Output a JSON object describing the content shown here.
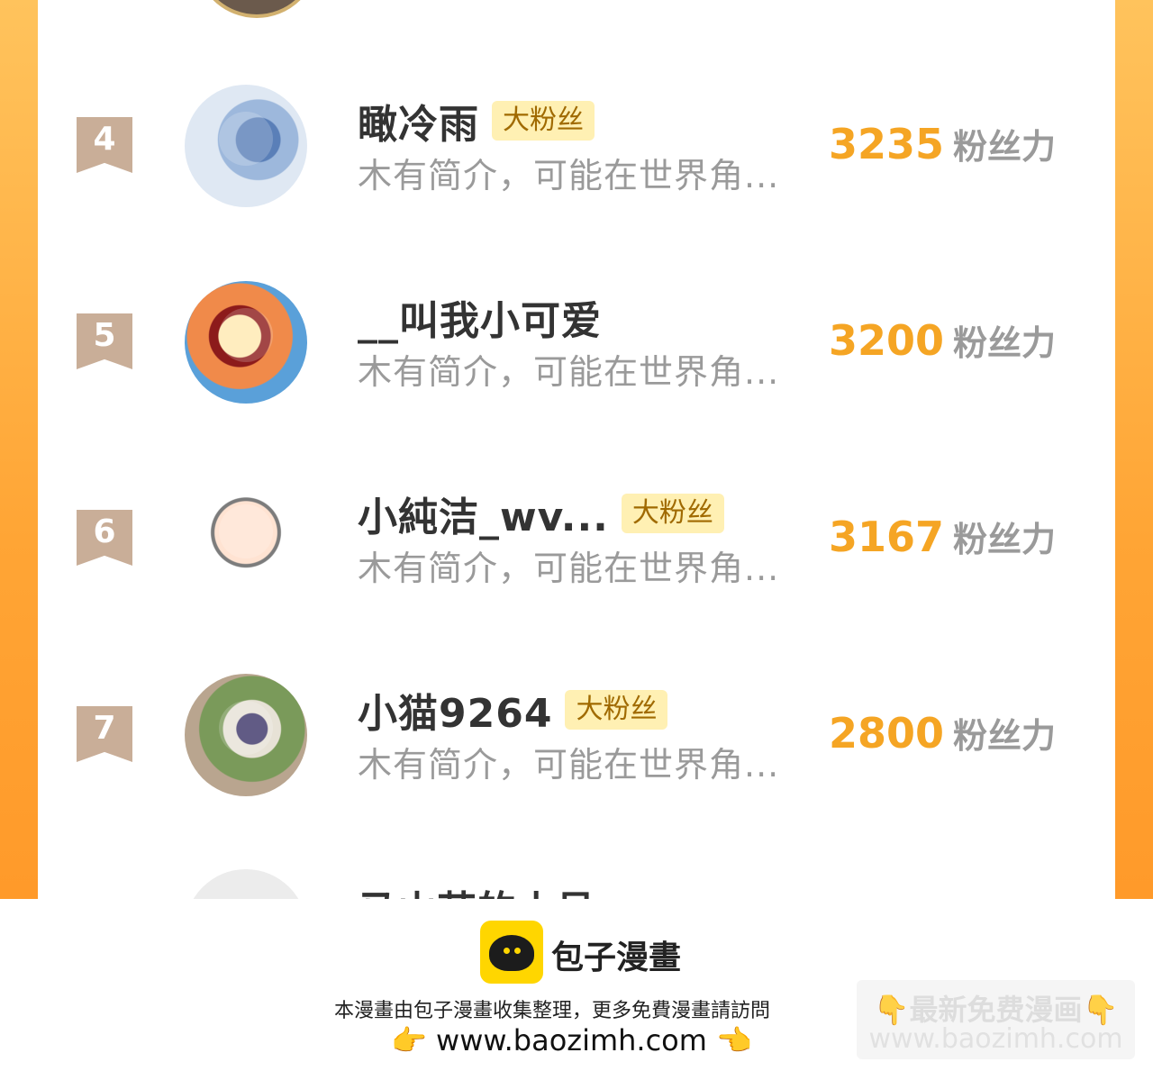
{
  "leaderboard": {
    "rows": [
      {
        "rank": "4",
        "name": "瞰冷雨",
        "badge": "大粉丝",
        "bio": "木有简介，可能在世界角...",
        "score": "3235",
        "unit": "粉丝力"
      },
      {
        "rank": "5",
        "name": "__叫我小可爱",
        "badge": "",
        "bio": "木有简介，可能在世界角...",
        "score": "3200",
        "unit": "粉丝力"
      },
      {
        "rank": "6",
        "name": "小純洁_wv...",
        "badge": "大粉丝",
        "bio": "木有简介，可能在世界角...",
        "score": "3167",
        "unit": "粉丝力"
      },
      {
        "rank": "7",
        "name": "小猫9264",
        "badge": "大粉丝",
        "bio": "木有简介，可能在世界角...",
        "score": "2800",
        "unit": "粉丝力"
      }
    ],
    "partial_name": "马山芸的小号"
  },
  "footer": {
    "brand": "包子漫畫",
    "notice": "本漫畫由包子漫畫收集整理，更多免費漫畫請訪問",
    "url": "www.baozimh.com",
    "hand_left": "👉",
    "hand_right": "👈",
    "watermark_line1": "👇最新免费漫画👇",
    "watermark_line2": "www.baozimh.com"
  },
  "colors": {
    "accent": "#f5a524",
    "rank_badge": "#c9ae98",
    "fan_badge_bg": "#fff0b3",
    "border": "#ffa535",
    "logo": "#ffd600"
  }
}
